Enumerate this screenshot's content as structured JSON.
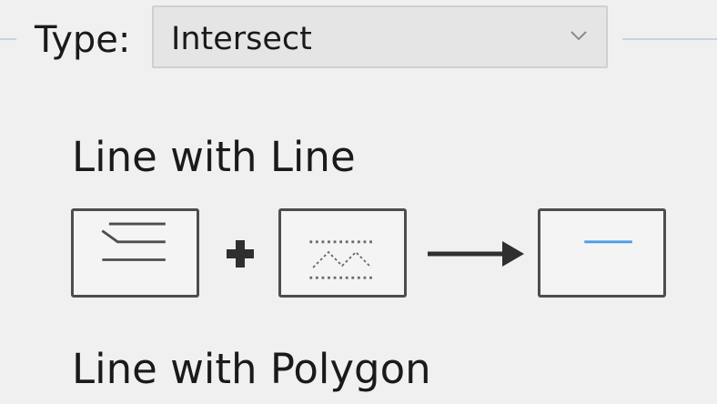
{
  "type_field": {
    "label": "Type:",
    "selected_value": "Intersect"
  },
  "sections": [
    {
      "title": "Line with Line"
    },
    {
      "title": "Line with Polygon"
    }
  ],
  "icons": {
    "chevron": "chevron-down-icon",
    "input_a": "lines-icon",
    "plus": "plus-icon",
    "input_b": "dashed-lines-icon",
    "arrow": "right-arrow-icon",
    "result": "result-line-icon"
  },
  "colors": {
    "background": "#f0f0f0",
    "select_background": "#e5e5e5",
    "result_line": "#4a9ee6",
    "icon_stroke": "#4d4d4d"
  }
}
